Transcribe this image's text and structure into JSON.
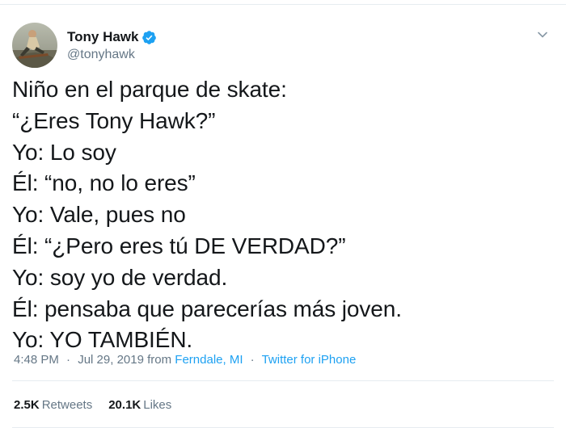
{
  "user": {
    "display_name": "Tony Hawk",
    "handle": "@tonyhawk",
    "verified": true
  },
  "tweet": {
    "lines": [
      "Niño en el parque de skate:",
      "“¿Eres Tony Hawk?”",
      "Yo: Lo soy",
      "Él: “no, no lo eres”",
      "Yo: Vale, pues no",
      "Él: “¿Pero eres tú DE VERDAD?”",
      "Yo: soy yo de verdad.",
      "Él: pensaba que parecerías más joven.",
      "Yo: YO TAMBIÉN."
    ],
    "time": "4:48 PM",
    "date": "Jul 29, 2019",
    "from_label": "from",
    "location": "Ferndale, MI",
    "source": "Twitter for iPhone",
    "separator": "·"
  },
  "stats": {
    "retweets_count": "2.5K",
    "retweets_label": "Retweets",
    "likes_count": "20.1K",
    "likes_label": "Likes"
  },
  "icons": {
    "verified": "verified-badge-icon",
    "menu": "chevron-down-icon"
  },
  "colors": {
    "accent": "#1da1f2",
    "text": "#14171a",
    "muted": "#657786",
    "border": "#e6ecf0"
  }
}
